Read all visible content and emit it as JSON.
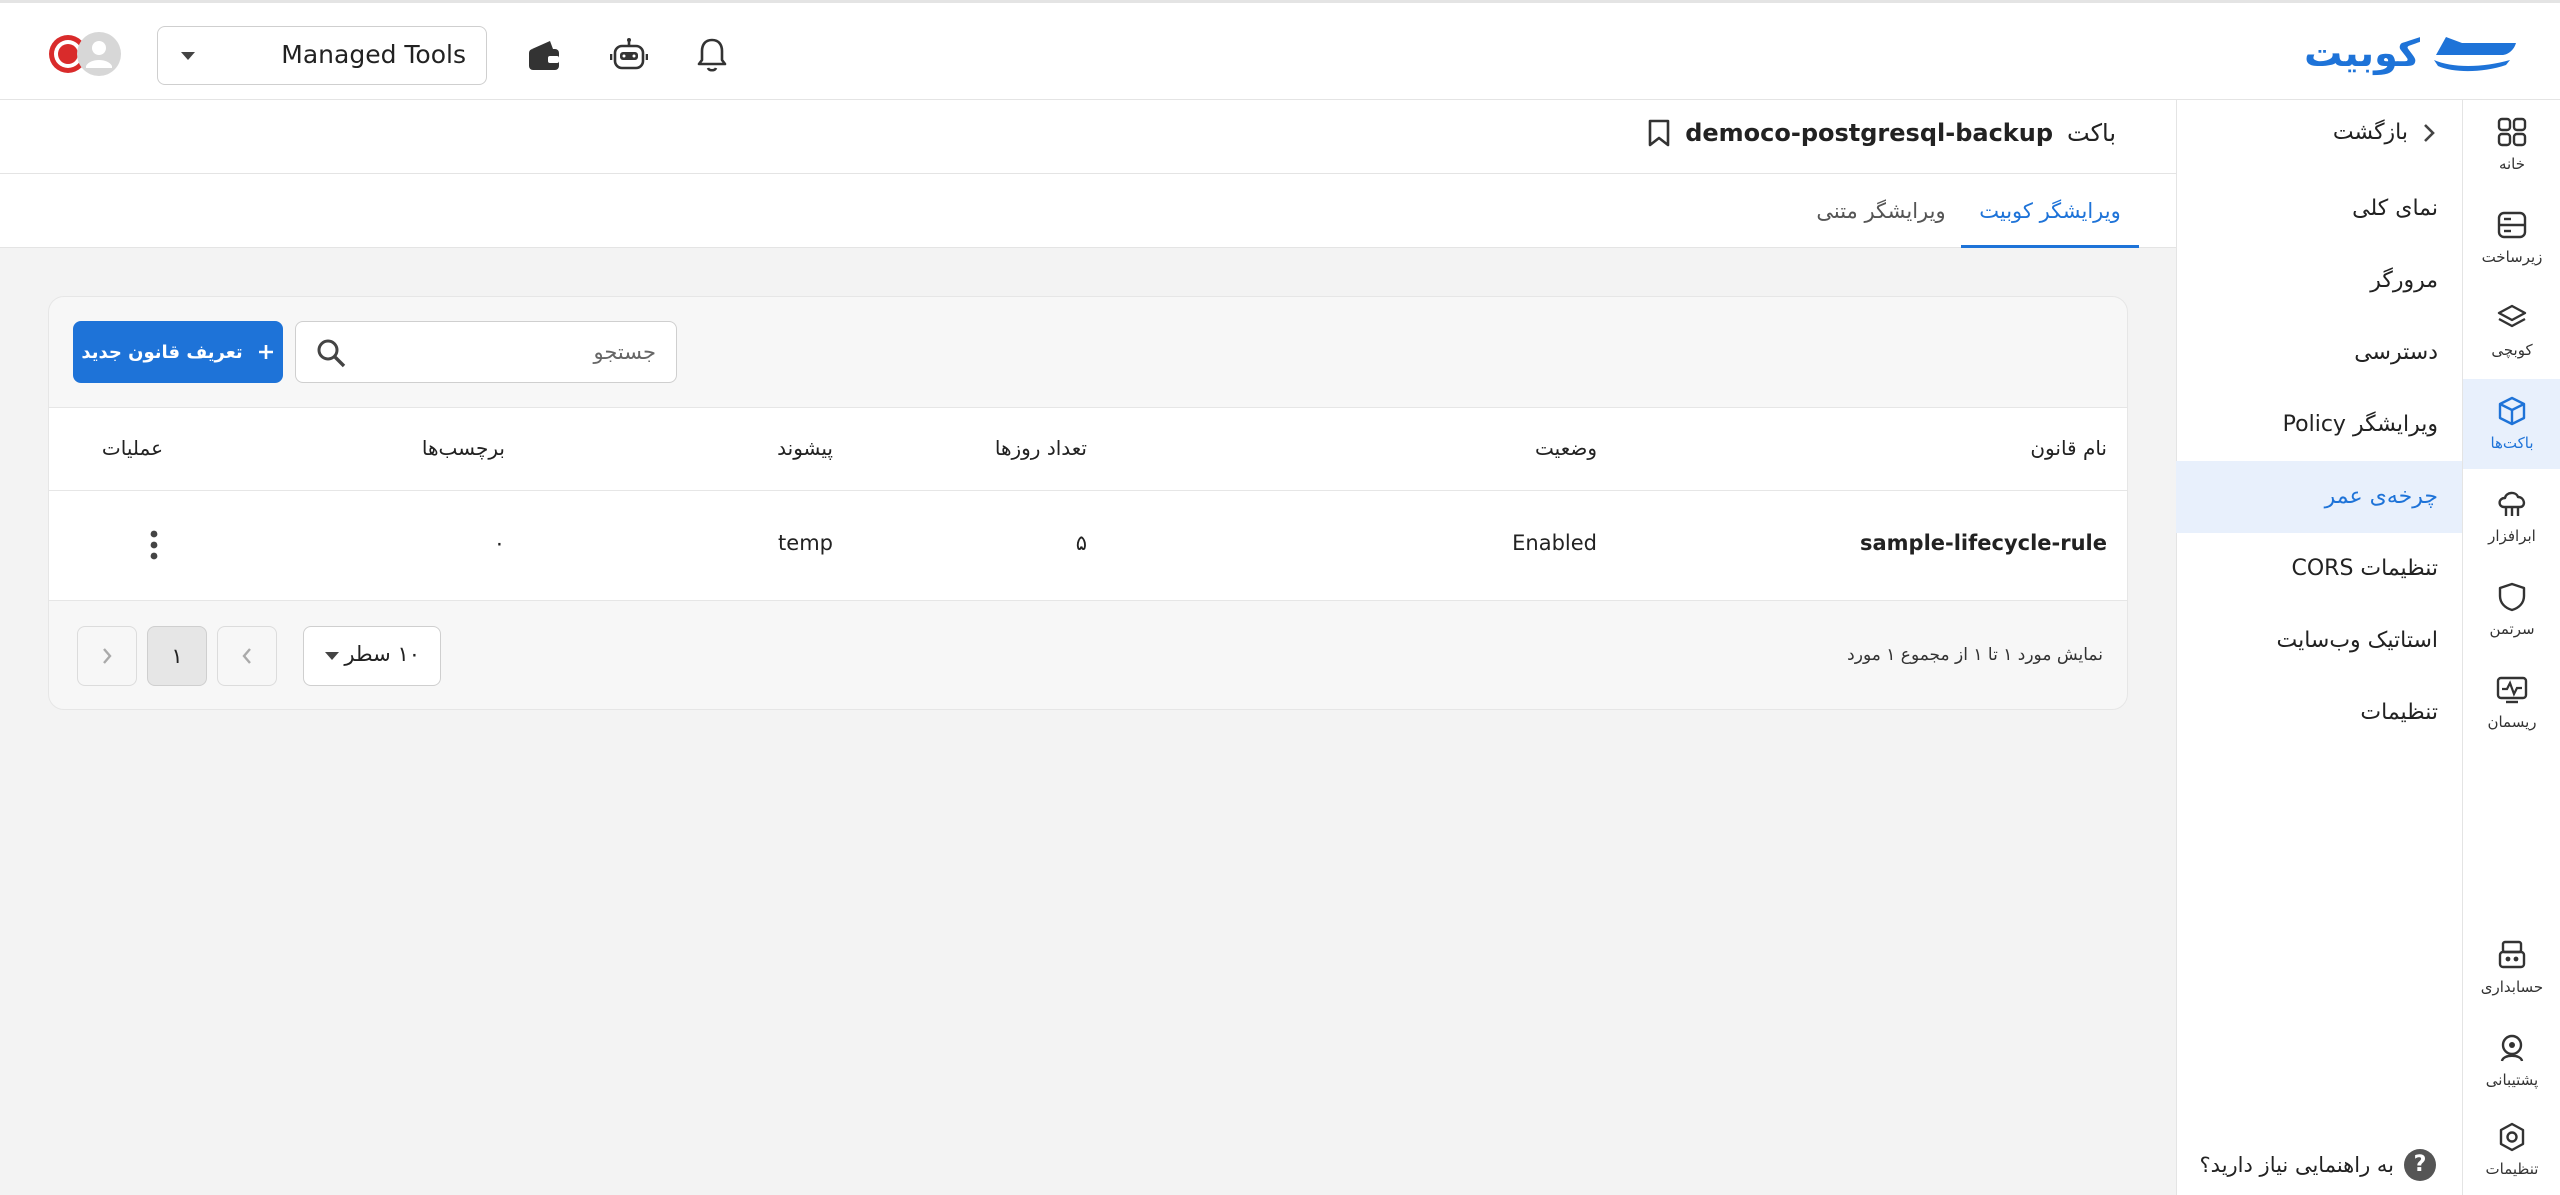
{
  "header": {
    "logo_text": "کوبیت",
    "workspace": "Managed Tools",
    "icons": [
      "notification-bell-icon",
      "robot-icon",
      "wallet-icon",
      "user-avatar-icon"
    ]
  },
  "rail": {
    "items": [
      {
        "label": "خانه",
        "icon": "grid-icon"
      },
      {
        "label": "زیرساخت",
        "icon": "server-icon"
      },
      {
        "label": "کوبچی",
        "icon": "layers-icon"
      },
      {
        "label": "باکت‌ها",
        "icon": "cube-icon"
      },
      {
        "label": "ابرافزار",
        "icon": "cloud-app-icon"
      },
      {
        "label": "سرتمن",
        "icon": "shield-icon"
      },
      {
        "label": "ریسمان",
        "icon": "monitor-icon"
      },
      {
        "label": "حسابداری",
        "icon": "billing-icon"
      },
      {
        "label": "پشتیبانی",
        "icon": "support-icon"
      },
      {
        "label": "تنظیمات",
        "icon": "settings-hex-icon"
      }
    ]
  },
  "subnav": {
    "back": "بازگشت",
    "items": [
      {
        "label": "نمای کلی"
      },
      {
        "label": "مرورگر"
      },
      {
        "label": "دسترسی"
      },
      {
        "label": "ویرایشگر Policy"
      },
      {
        "label": "چرخه‌ی عمر"
      },
      {
        "label": "تنظیمات CORS"
      },
      {
        "label": "استاتیک وب‌سایت"
      },
      {
        "label": "تنظیمات"
      }
    ],
    "help": "به راهنمایی نیاز دارید؟",
    "help_symbol": "?"
  },
  "page": {
    "title_prefix": "باکت",
    "bucket_name": "democo-postgresql-backup",
    "tabs": {
      "visual": "ویرایشگر کوبیت",
      "text": "ویرایشگر متنی"
    }
  },
  "toolbar": {
    "new_rule": "تعریف قانون جدید",
    "search_placeholder": "جستجو"
  },
  "table": {
    "columns": {
      "name": "نام قانون",
      "status": "وضعیت",
      "days": "تعداد روزها",
      "prefix": "پیشوند",
      "tags": "برچسب‌ها",
      "actions": "عملیات"
    },
    "rows": [
      {
        "name": "sample-lifecycle-rule",
        "status": "Enabled",
        "days": "۵",
        "prefix": "temp",
        "tags": "۰"
      }
    ]
  },
  "pagination": {
    "summary": "نمایش مورد ۱ تا ۱ از مجموع ۱ مورد",
    "rows_per_page": "۱۰ سطر",
    "current_page": "۱"
  },
  "colors": {
    "accent": "#1e73d8",
    "active_bg": "#e8f0fc"
  }
}
